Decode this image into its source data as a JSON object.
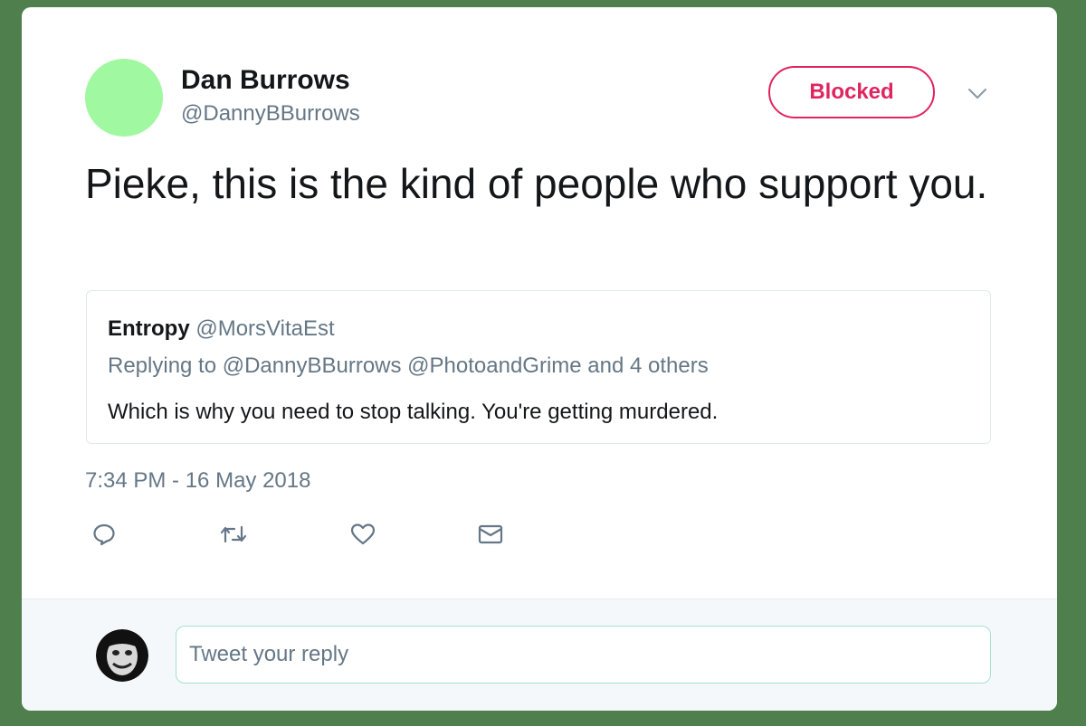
{
  "tweet": {
    "author_name": "Dan Burrows",
    "author_handle": "@DannyBBurrows",
    "avatar_color": "#a0f8a0",
    "follow_status_label": "Blocked",
    "text": "Pieke, this is the kind of people who support you.",
    "timestamp": "7:34 PM - 16 May 2018"
  },
  "quoted_tweet": {
    "author_name": "Entropy",
    "author_handle": "@MorsVitaEst",
    "replying_to": "Replying to @DannyBBurrows @PhotoandGrime and 4 others",
    "text": "Which is why you need to stop talking. You're getting murdered."
  },
  "actions": [
    {
      "name": "reply",
      "icon": "reply-icon"
    },
    {
      "name": "retweet",
      "icon": "retweet-icon"
    },
    {
      "name": "like",
      "icon": "heart-icon"
    },
    {
      "name": "direct-message",
      "icon": "envelope-icon"
    }
  ],
  "reply_box": {
    "placeholder": "Tweet your reply"
  },
  "colors": {
    "accent_blocked": "#e0245e",
    "secondary_text": "#657786",
    "background": "#4f7f4d"
  }
}
